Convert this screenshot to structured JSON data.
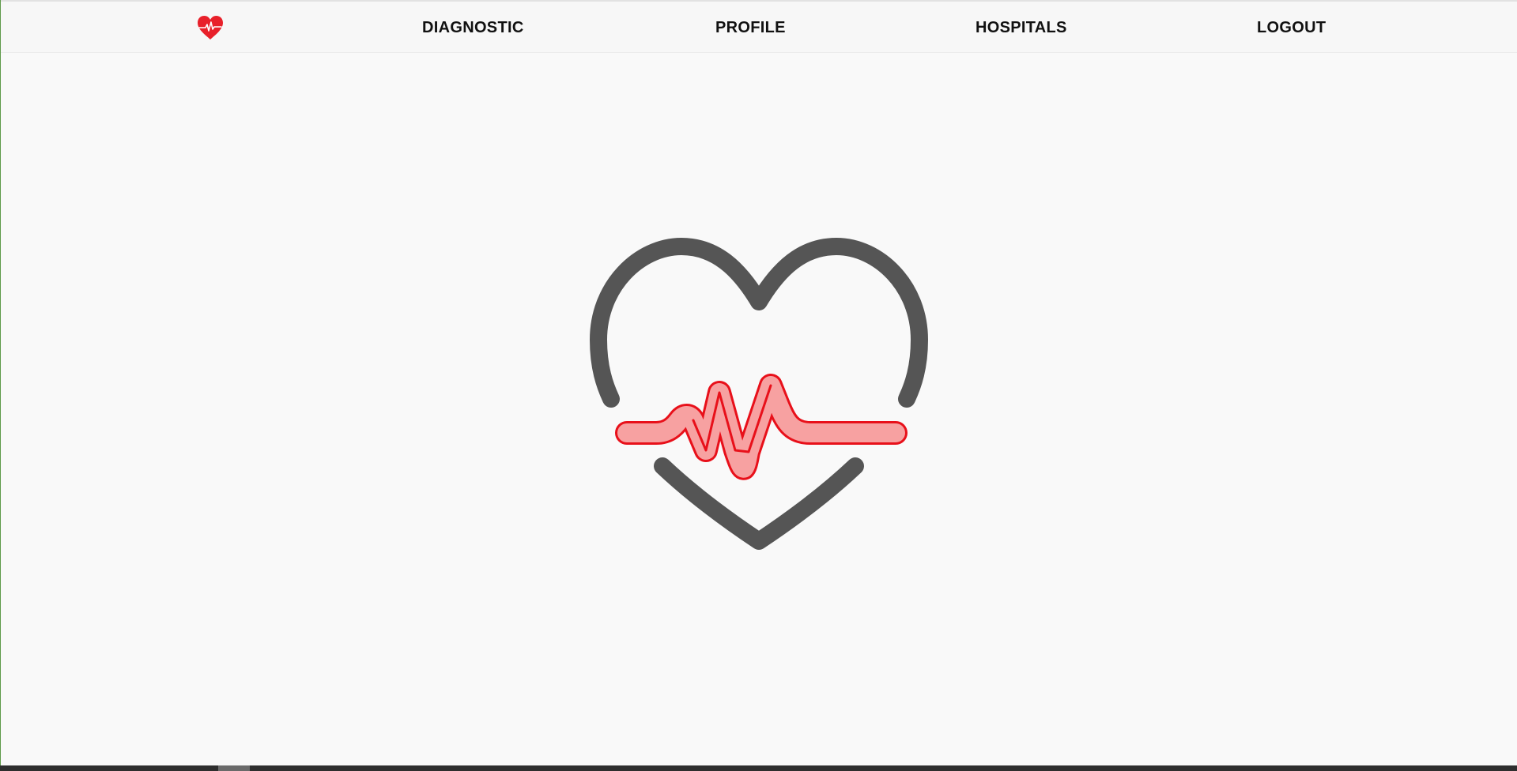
{
  "nav": {
    "logo_icon": "heart-pulse-icon",
    "brand_color": "#e8202a",
    "items": [
      {
        "label": "DIAGNOSTIC"
      },
      {
        "label": "PROFILE"
      },
      {
        "label": "HOSPITALS"
      },
      {
        "label": "LOGOUT"
      }
    ]
  },
  "hero": {
    "icon": "heart-pulse-illustration",
    "outline_color": "#555555",
    "pulse_stroke_color": "#e8101a",
    "pulse_fill_color": "#f7a1a1"
  }
}
